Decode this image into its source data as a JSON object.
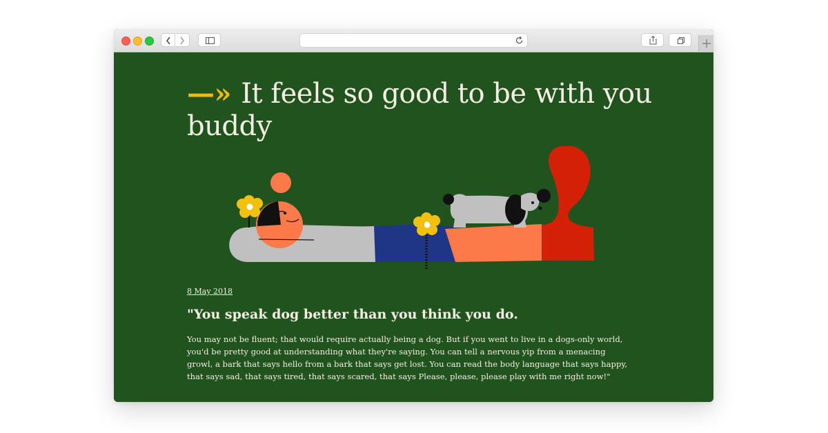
{
  "colors": {
    "background_green": "#21531f",
    "text_cream": "#f4efe3",
    "accent_yellow": "#f2b90f",
    "coral": "#fc7a4a",
    "red": "#d52008",
    "navy": "#1f3686",
    "grey": "#c0c0c0"
  },
  "browser": {
    "url": "",
    "icons": {
      "back": "chevron-left-icon",
      "forward": "chevron-right-icon",
      "sidebar": "sidebar-icon",
      "reload": "reload-icon",
      "share": "share-icon",
      "tabs": "tabs-icon",
      "new_tab": "plus-icon"
    }
  },
  "article": {
    "arrow": "—»",
    "headline": "It feels so good to be with you buddy",
    "date": "8 May 2018",
    "quote_title": "\"You speak dog better than you think you do.",
    "body": "You may not be fluent; that would require actually being a dog. But if you went to live in a dogs-only world, you'd be pretty good at understanding what they're saying. You can tell a nervous yip from a menacing growl, a bark that says hello from a bark that says get lost. You can read the body language that says happy, that says sad, that says tired, that says scared, that says Please, please, please play with me right now!\""
  }
}
